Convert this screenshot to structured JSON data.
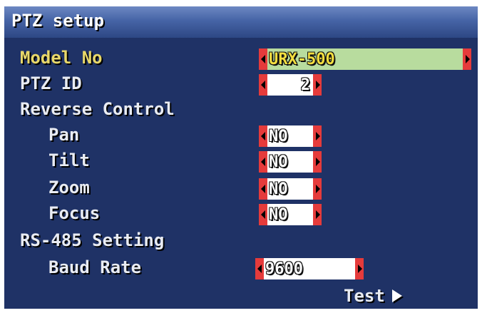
{
  "title": "PTZ setup",
  "rows": {
    "model_no": {
      "label": "Model No",
      "value": "URX-500"
    },
    "ptz_id": {
      "label": "PTZ ID",
      "value": "2"
    },
    "reverse_control": {
      "label": "Reverse Control"
    },
    "pan": {
      "label": "Pan",
      "value": "NO"
    },
    "tilt": {
      "label": "Tilt",
      "value": "NO"
    },
    "zoom": {
      "label": "Zoom",
      "value": "NO"
    },
    "focus": {
      "label": "Focus",
      "value": "NO"
    },
    "rs485": {
      "label": "RS-485 Setting"
    },
    "baud_rate": {
      "label": "Baud Rate",
      "value": "9600"
    }
  },
  "test_label": "Test",
  "icons": {
    "arrow_left": "arrow-left-icon",
    "arrow_right": "arrow-right-icon",
    "play": "play-icon"
  },
  "colors": {
    "background": "#1f3266",
    "title_bar": "#4664a6",
    "selected_label": "#e8d86a",
    "selected_field": "#b8dc9e",
    "arrow": "#e53b3b"
  }
}
